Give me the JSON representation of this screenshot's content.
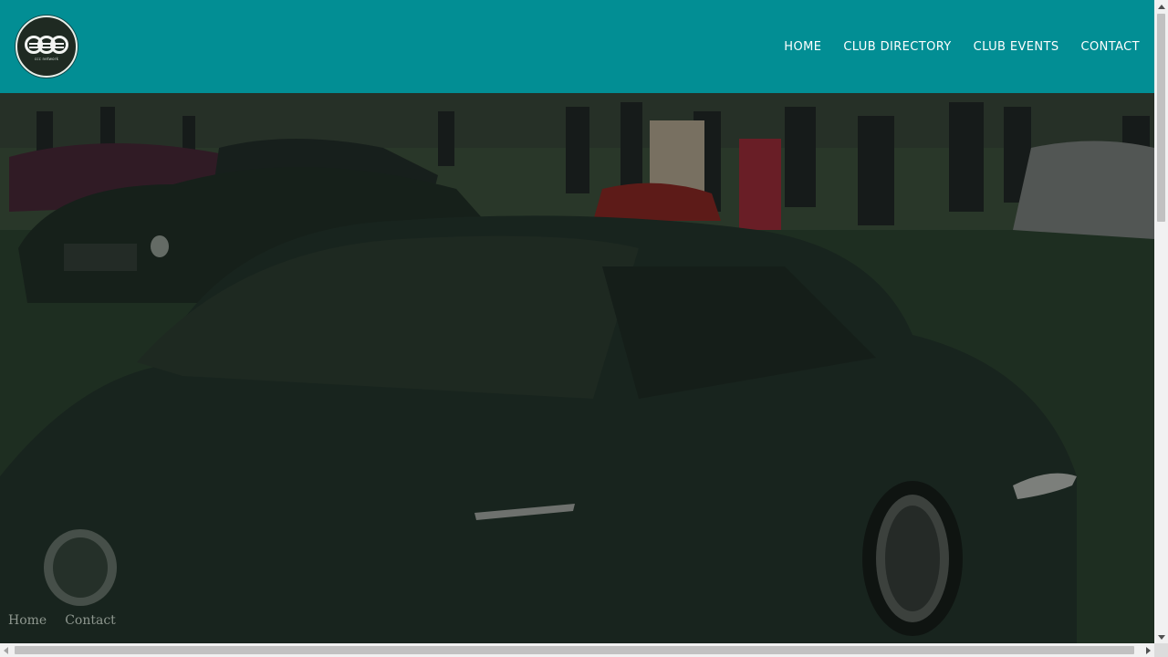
{
  "brand": {
    "logo_text": "ccc network"
  },
  "nav": {
    "home": "HOME",
    "club_directory": "CLUB DIRECTORY",
    "club_events": "CLUB EVENTS",
    "contact": "CONTACT"
  },
  "hero": {
    "image": "classic-car-concours-photo"
  },
  "footer": {
    "home": "Home",
    "contact": "Contact"
  },
  "colors": {
    "header": "#028e94",
    "nav_text": "#ffffff",
    "footer_link": "#8e978f"
  }
}
